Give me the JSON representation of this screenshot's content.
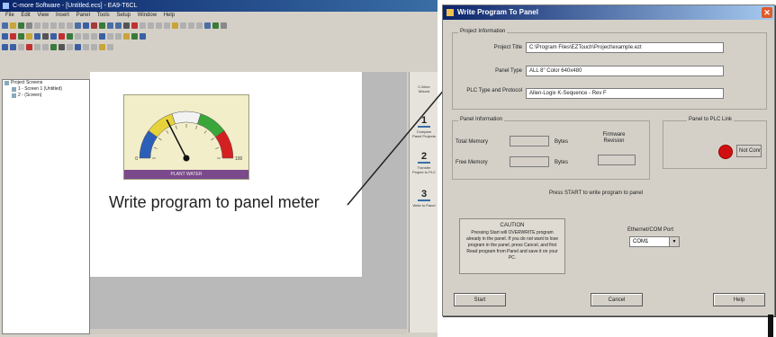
{
  "editor": {
    "window_title": "C-more Software - [Untitled.ecs] - EA9-T6CL",
    "menu": [
      "File",
      "Edit",
      "View",
      "Insert",
      "Panel",
      "Tools",
      "Setup",
      "Window",
      "Help"
    ],
    "tree_items": [
      "Project Screens",
      "1 - Screen 1 (Untitled)",
      "2 - (Screen)"
    ],
    "meter": {
      "scale_min": "0",
      "scale_max": "100",
      "bar_label": "PLANT WATER",
      "needle_fraction": 0.35,
      "band_colors": [
        "#2b5fb8",
        "#e6d23a",
        "#f2f2f2",
        "#3aa63a",
        "#d42020"
      ]
    },
    "steps": [
      {
        "num": "1",
        "label": "Compare Panel Projects"
      },
      {
        "num": "2",
        "label": "Transfer Project to PLC"
      },
      {
        "num": "3",
        "label": "Write to Panel"
      }
    ],
    "steps_header": "C-More Wizard"
  },
  "caption": "Write program to panel meter",
  "dialog": {
    "title": "Write Program To Panel",
    "close_glyph": "✕",
    "project_info_title": "Project Information",
    "project_title_label": "Project Title",
    "project_title_value": "C:\\Program Files\\EZTouch\\Project\\example.ezt",
    "panel_type_label": "Panel Type",
    "panel_type_value": "ALL 8\" Color 640x480",
    "plc_type_label": "PLC Type and Protocol",
    "plc_type_value": "Allen-Logix K-Sequence - Rev F",
    "panel_info_title": "Panel Information",
    "total_memory_label": "Total Memory",
    "free_memory_label": "Free Memory",
    "bytes_label": "Bytes",
    "firmware_label": "Firmware Revision",
    "plc_link_title": "Panel to PLC Link",
    "link_status": "Not Connected",
    "link_status_color": "#d01010",
    "instruction": "Press START to write program to panel",
    "caution_title": "CAUTION",
    "caution_text": "Pressing Start will OVERWRITE program already in the panel. If you do not want to lose program in the panel, press Cancel, and first Read program from Panel and save it on your PC.",
    "port_label": "Ethernet/COM Port",
    "port_value": "COM1",
    "start_label": "Start",
    "cancel_label": "Cancel",
    "help_label": "Help"
  }
}
